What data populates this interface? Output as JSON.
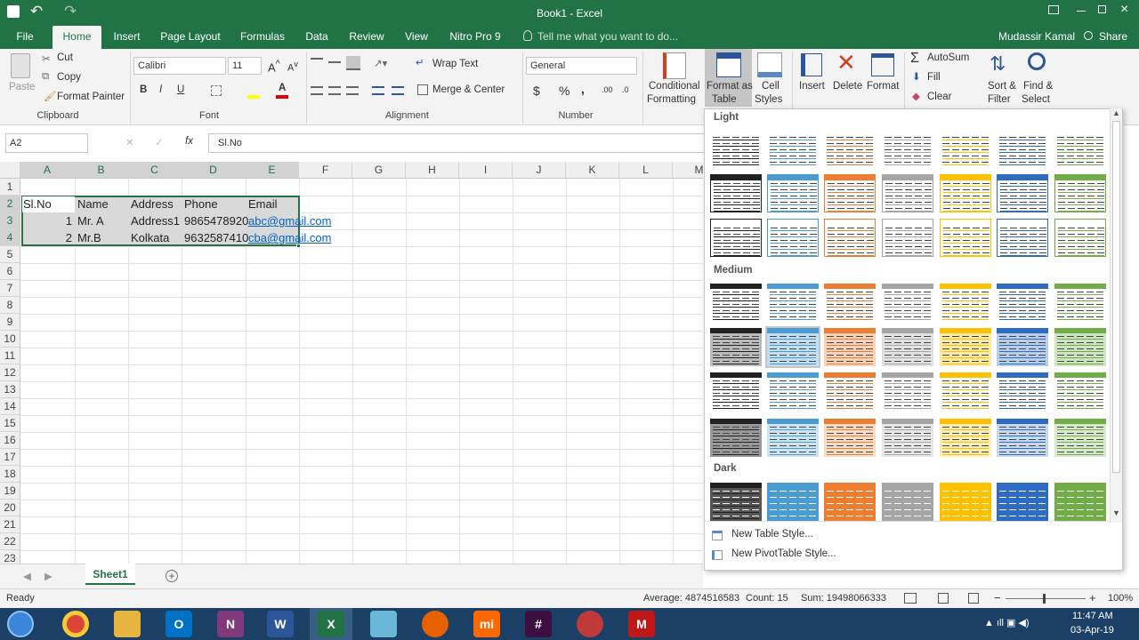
{
  "window": {
    "title": "Book1 - Excel"
  },
  "quick_access": {
    "undo": "↶",
    "redo": "↷"
  },
  "ribbon_tabs": [
    "File",
    "Home",
    "Insert",
    "Page Layout",
    "Formulas",
    "Data",
    "Review",
    "View",
    "Nitro Pro 9"
  ],
  "tell_me": "Tell me what you want to do...",
  "user": {
    "name": "Mudassir Kamal",
    "share": "Share"
  },
  "clipboard": {
    "paste": "Paste",
    "cut": "Cut",
    "copy": "Copy",
    "format_painter": "Format Painter",
    "label": "Clipboard"
  },
  "font": {
    "name": "Calibri",
    "size": "11",
    "bold": "B",
    "italic": "I",
    "underline": "U",
    "label": "Font"
  },
  "alignment": {
    "wrap": "Wrap Text",
    "merge": "Merge & Center",
    "label": "Alignment"
  },
  "number": {
    "format": "General",
    "currency": "$",
    "percent": "%",
    "comma": ",",
    "label": "Number"
  },
  "styles": {
    "conditional": "Conditional",
    "conditional2": "Formatting",
    "fmt_table": "Format as",
    "fmt_table2": "Table",
    "cell_styles": "Cell",
    "cell_styles2": "Styles"
  },
  "cells": {
    "insert": "Insert",
    "delete": "Delete",
    "format": "Format"
  },
  "editing": {
    "autosum": "AutoSum",
    "fill": "Fill",
    "clear": "Clear",
    "sort": "Sort &",
    "sort2": "Filter",
    "find": "Find &",
    "find2": "Select"
  },
  "name_box": "A2",
  "formula_bar": {
    "fx": "fx",
    "value": "Sl.No"
  },
  "columns": [
    "A",
    "B",
    "C",
    "D",
    "E",
    "F",
    "G",
    "H",
    "I",
    "J",
    "K",
    "L",
    "M"
  ],
  "rows": [
    "1",
    "2",
    "3",
    "4",
    "5",
    "6",
    "7",
    "8",
    "9",
    "10",
    "11",
    "12",
    "13",
    "14",
    "15",
    "16",
    "17",
    "18",
    "19",
    "20",
    "21",
    "22",
    "23"
  ],
  "table": {
    "headers": [
      "Sl.No",
      "Name",
      "Address",
      "Phone",
      "Email"
    ],
    "rows": [
      [
        "1",
        "Mr. A",
        "Address1",
        "9865478920",
        "abc@gmail.com"
      ],
      [
        "2",
        "Mr.B",
        "Kolkata",
        "9632587410",
        "cba@gmail.com"
      ]
    ]
  },
  "sheet_tabs": [
    "Sheet1"
  ],
  "status": {
    "ready": "Ready",
    "average": "Average: 4874516583",
    "count": "Count: 15",
    "sum": "Sum: 19498066333",
    "zoom": "100%"
  },
  "gallery": {
    "light": "Light",
    "medium": "Medium",
    "dark": "Dark",
    "new_table_style": "New Table Style...",
    "new_pivot_style": "New PivotTable Style...",
    "colors": [
      "#000000",
      "#4a9bd1",
      "#ed7d31",
      "#a5a5a5",
      "#ffc000",
      "#2e6bc2",
      "#70ad47"
    ]
  },
  "taskbar": {
    "time": "11:47 AM",
    "date": "03-Apr-19"
  }
}
